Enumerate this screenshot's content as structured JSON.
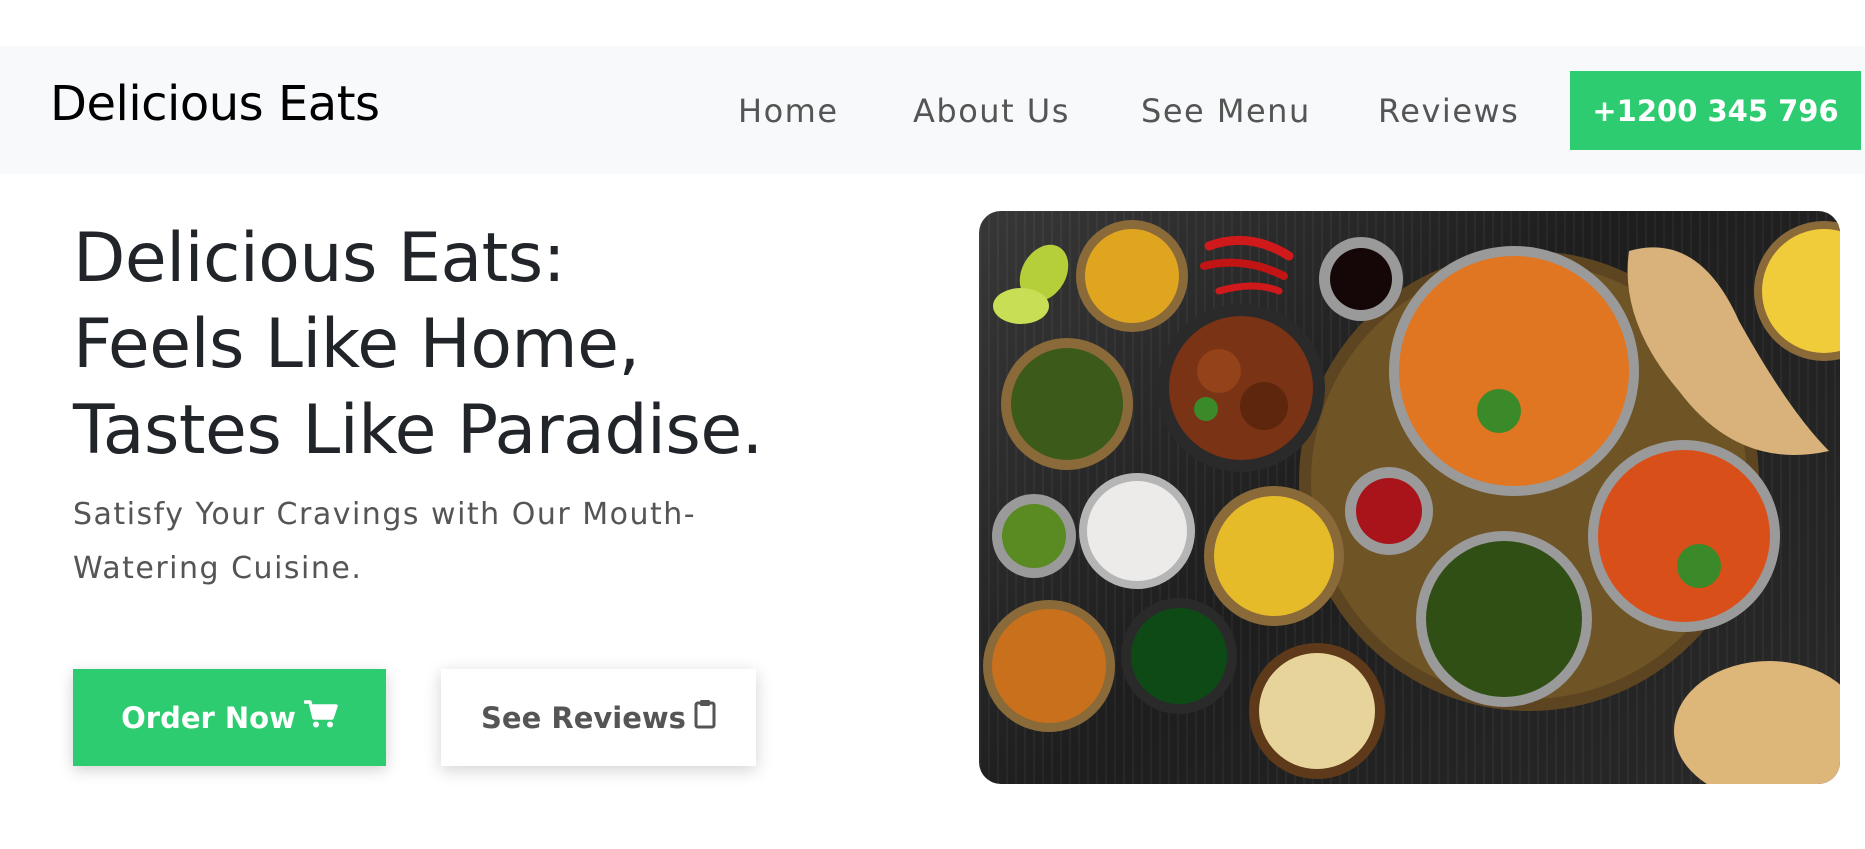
{
  "header": {
    "brand": "Delicious Eats",
    "nav": [
      {
        "label": "Home"
      },
      {
        "label": "About Us"
      },
      {
        "label": "See Menu"
      },
      {
        "label": "Reviews"
      }
    ],
    "phone": "+1200 345 796"
  },
  "hero": {
    "title_lines": [
      "Delicious Eats:",
      "Feels Like Home,",
      "Tastes Like Paradise."
    ],
    "subtitle": "Satisfy Your Cravings with Our Mouth-Watering Cuisine.",
    "order_button": {
      "label": "Order Now",
      "icon": "cart-icon"
    },
    "reviews_button": {
      "label": "See Reviews",
      "icon": "clipboard-icon"
    },
    "image": {
      "subject": "food-spread-image"
    }
  },
  "colors": {
    "accent": "#2ecc71",
    "navbar_bg": "#f8f9fa",
    "heading": "#212529",
    "muted_text": "#555555"
  }
}
